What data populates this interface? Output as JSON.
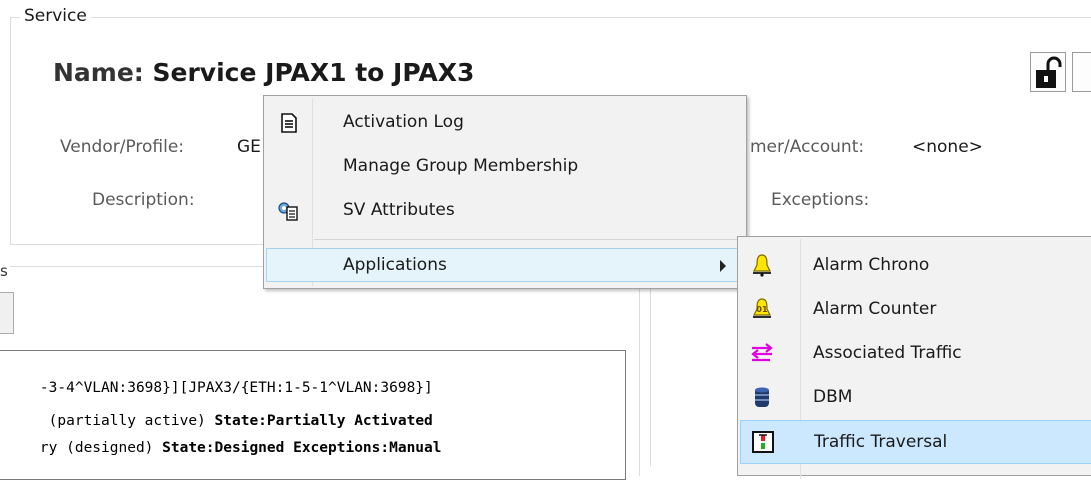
{
  "service": {
    "group_title": "Service",
    "name_label": "Name:",
    "name_value": "Service JPAX1 to JPAX3",
    "vendor_label": "Vendor/Profile:",
    "vendor_value": "GE",
    "description_label": "Description:",
    "customer_label": "mer/Account:",
    "customer_value": "<none>",
    "exceptions_label": "Exceptions:"
  },
  "left_panel": {
    "label_fragment": "s",
    "log_lines": [
      {
        "text": "-3-4^VLAN:3698}][JPAX3/{ETH:1-5-1^VLAN:3698}]",
        "bold": ""
      },
      {
        "text": " (partially active) ",
        "bold": "State:Partially Activated "
      },
      {
        "text": "ry (designed) ",
        "bold": "State:Designed Exceptions:Manual"
      }
    ]
  },
  "context_menu": {
    "items": [
      {
        "label": "Activation Log",
        "icon": "log-document-icon"
      },
      {
        "label": "Manage Group Membership",
        "icon": ""
      },
      {
        "label": "SV Attributes",
        "icon": "attributes-icon"
      },
      {
        "label": "Applications",
        "icon": "",
        "has_submenu": true
      }
    ]
  },
  "applications_menu": {
    "items": [
      {
        "label": "Alarm Chrono",
        "icon": "alarm-bell-icon"
      },
      {
        "label": "Alarm Counter",
        "icon": "alarm-counter-icon"
      },
      {
        "label": "Associated Traffic",
        "icon": "associated-traffic-icon"
      },
      {
        "label": "DBM",
        "icon": "database-icon"
      },
      {
        "label": "Traffic Traversal",
        "icon": "traffic-traversal-icon"
      }
    ]
  },
  "colors": {
    "menu_bg": "#f2f2f2",
    "highlight": "#cce8ff",
    "hover": "#e5f3fb"
  }
}
